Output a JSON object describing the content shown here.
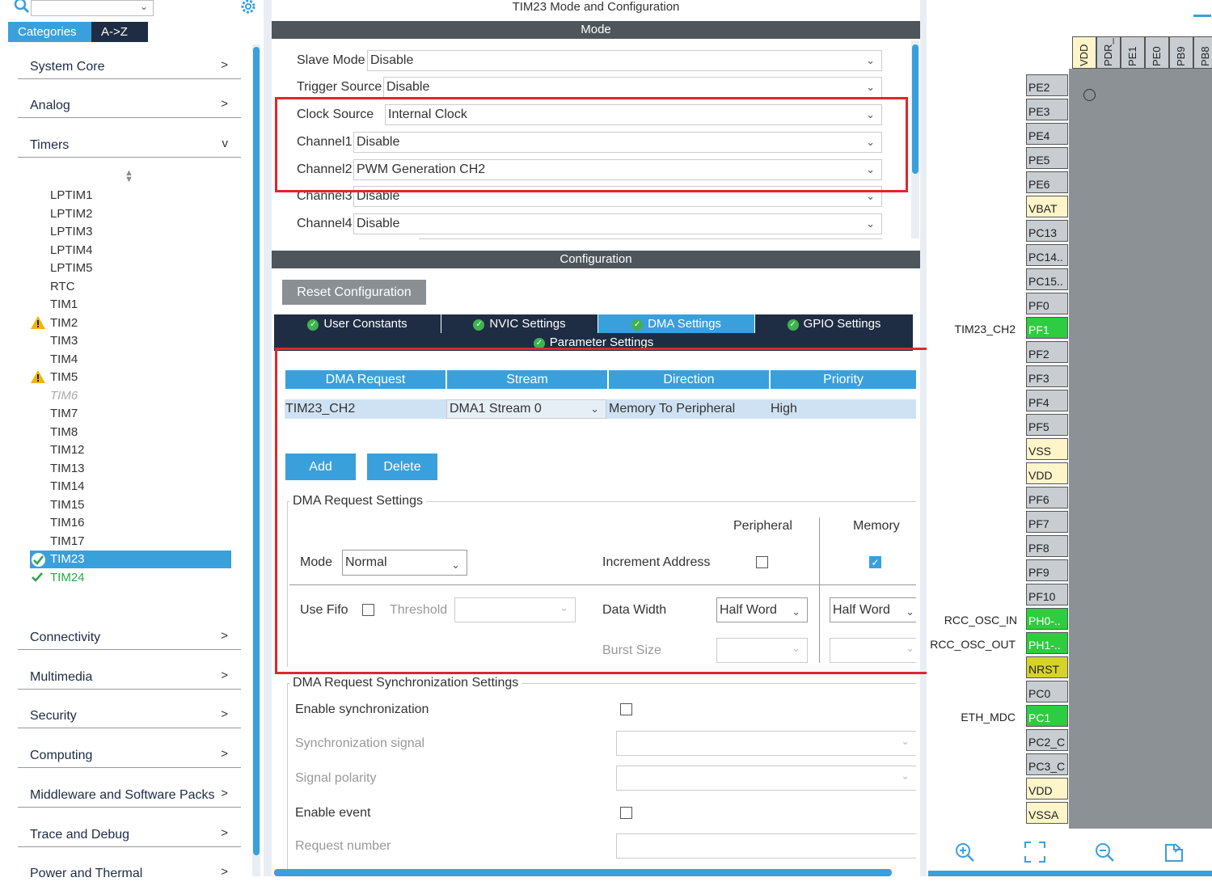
{
  "left": {
    "search_placeholder": "",
    "tabs": [
      "Categories",
      "A->Z"
    ],
    "categories_top": [
      {
        "label": "System Core",
        "chevron": ">"
      },
      {
        "label": "Analog",
        "chevron": ">"
      },
      {
        "label": "Timers",
        "chevron": "v"
      }
    ],
    "timers": [
      "LPTIM1",
      "LPTIM2",
      "LPTIM3",
      "LPTIM4",
      "LPTIM5",
      "RTC",
      "TIM1",
      "TIM2",
      "TIM3",
      "TIM4",
      "TIM5",
      "TIM6",
      "TIM7",
      "TIM8",
      "TIM12",
      "TIM13",
      "TIM14",
      "TIM15",
      "TIM16",
      "TIM17",
      "TIM23",
      "TIM24"
    ],
    "categories_bottom": [
      {
        "label": "Connectivity",
        "chevron": ">"
      },
      {
        "label": "Multimedia",
        "chevron": ">"
      },
      {
        "label": "Security",
        "chevron": ">"
      },
      {
        "label": "Computing",
        "chevron": ">"
      },
      {
        "label": "Middleware and Software Packs",
        "chevron": ">"
      },
      {
        "label": "Trace and Debug",
        "chevron": ">"
      },
      {
        "label": "Power and Thermal",
        "chevron": ">"
      }
    ]
  },
  "mid": {
    "title": "TIM23 Mode and Configuration",
    "mode_header": "Mode",
    "mode_rows": [
      {
        "label": "Slave Mode",
        "value": "Disable"
      },
      {
        "label": "Trigger Source",
        "value": "Disable"
      },
      {
        "label": "Clock Source",
        "value": "Internal Clock"
      },
      {
        "label": "Channel1",
        "value": "Disable"
      },
      {
        "label": "Channel2",
        "value": "PWM Generation CH2"
      },
      {
        "label": "Channel3",
        "value": "Disable"
      },
      {
        "label": "Channel4",
        "value": "Disable"
      }
    ],
    "config_header": "Configuration",
    "reset_btn": "Reset Configuration",
    "tabs": [
      "User Constants",
      "NVIC Settings",
      "DMA Settings",
      "GPIO Settings"
    ],
    "tab_param": "Parameter Settings",
    "dma_table": {
      "headers": [
        "DMA Request",
        "Stream",
        "Direction",
        "Priority"
      ],
      "row": [
        "TIM23_CH2",
        "DMA1 Stream 0",
        "Memory To Peripheral",
        "High"
      ]
    },
    "add_btn": "Add",
    "delete_btn": "Delete",
    "req_settings": {
      "legend": "DMA Request Settings",
      "peripheral": "Peripheral",
      "memory": "Memory",
      "mode_label": "Mode",
      "mode_value": "Normal",
      "incr_label": "Increment Address",
      "use_fifo": "Use Fifo",
      "threshold": "Threshold",
      "data_width": "Data Width",
      "periph_width": "Half Word",
      "mem_width": "Half Word",
      "burst_size": "Burst Size"
    },
    "sync_settings": {
      "legend": "DMA Request Synchronization Settings",
      "enable_sync": "Enable synchronization",
      "sync_signal": "Synchronization signal",
      "signal_polarity": "Signal polarity",
      "enable_event": "Enable event",
      "request_number": "Request number"
    }
  },
  "right": {
    "top_pins": [
      "VDD",
      "PDR_",
      "PE1",
      "PE0",
      "PB9",
      "PB8"
    ],
    "pins": [
      {
        "name": "PE2",
        "kind": "io"
      },
      {
        "name": "PE3",
        "kind": "io"
      },
      {
        "name": "PE4",
        "kind": "io"
      },
      {
        "name": "PE5",
        "kind": "io"
      },
      {
        "name": "PE6",
        "kind": "io"
      },
      {
        "name": "VBAT",
        "kind": "pwr"
      },
      {
        "name": "PC13",
        "kind": "io"
      },
      {
        "name": "PC14..",
        "kind": "io"
      },
      {
        "name": "PC15..",
        "kind": "io"
      },
      {
        "name": "PF0",
        "kind": "io"
      },
      {
        "name": "PF1",
        "kind": "grn"
      },
      {
        "name": "PF2",
        "kind": "io"
      },
      {
        "name": "PF3",
        "kind": "io"
      },
      {
        "name": "PF4",
        "kind": "io"
      },
      {
        "name": "PF5",
        "kind": "io"
      },
      {
        "name": "VSS",
        "kind": "pwr"
      },
      {
        "name": "VDD",
        "kind": "pwr"
      },
      {
        "name": "PF6",
        "kind": "io"
      },
      {
        "name": "PF7",
        "kind": "io"
      },
      {
        "name": "PF8",
        "kind": "io"
      },
      {
        "name": "PF9",
        "kind": "io"
      },
      {
        "name": "PF10",
        "kind": "io"
      },
      {
        "name": "PH0-..",
        "kind": "grn"
      },
      {
        "name": "PH1-..",
        "kind": "grn"
      },
      {
        "name": "NRST",
        "kind": "ylw"
      },
      {
        "name": "PC0",
        "kind": "io"
      },
      {
        "name": "PC1",
        "kind": "grn"
      },
      {
        "name": "PC2_C",
        "kind": "io"
      },
      {
        "name": "PC3_C",
        "kind": "io"
      },
      {
        "name": "VDD",
        "kind": "pwr"
      },
      {
        "name": "VSSA",
        "kind": "pwr"
      }
    ],
    "pin_labels": {
      "pf1": "TIM23_CH2",
      "ph0": "RCC_OSC_IN",
      "ph1": "RCC_OSC_OUT",
      "pc1": "ETH_MDC"
    }
  },
  "colors": {
    "accent": "#3aa0dc",
    "dark": "#1f2d44",
    "highlight": "#e0262c",
    "pin_green": "#2ecc40"
  }
}
